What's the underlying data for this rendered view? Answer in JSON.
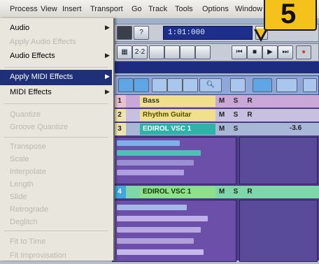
{
  "menubar": {
    "items": [
      "Process",
      "View",
      "Insert",
      "Transport",
      "Go",
      "Track",
      "Tools",
      "Options",
      "Window"
    ]
  },
  "menu": {
    "items": [
      {
        "label": "Audio",
        "submenu": true,
        "enabled": true
      },
      {
        "label": "Apply Audio Effects",
        "submenu": false,
        "enabled": false
      },
      {
        "label": "Audio Effects",
        "submenu": true,
        "enabled": true
      },
      {
        "label": "Apply MIDI Effects",
        "submenu": true,
        "enabled": true,
        "highlighted": true
      },
      {
        "label": "MIDI Effects",
        "submenu": true,
        "enabled": true
      },
      {
        "label": "Quantize",
        "submenu": false,
        "enabled": false
      },
      {
        "label": "Groove Quantize",
        "submenu": false,
        "enabled": false
      },
      {
        "label": "Transpose",
        "submenu": false,
        "enabled": false
      },
      {
        "label": "Scale",
        "submenu": false,
        "enabled": false
      },
      {
        "label": "Interpolate",
        "submenu": false,
        "enabled": false
      },
      {
        "label": "Length",
        "submenu": false,
        "enabled": false
      },
      {
        "label": "Slide",
        "submenu": false,
        "enabled": false
      },
      {
        "label": "Retrograde",
        "submenu": false,
        "enabled": false
      },
      {
        "label": "Deglitch",
        "submenu": false,
        "enabled": false
      },
      {
        "label": "Fit to Time",
        "submenu": false,
        "enabled": false
      },
      {
        "label": "Fit Improvisation",
        "submenu": false,
        "enabled": false
      }
    ]
  },
  "transport": {
    "counter": "1:01:000",
    "help_label": "?"
  },
  "toolbar": {
    "button_2x2": "2·2"
  },
  "tracks": [
    {
      "number": "1",
      "name": "Bass",
      "mute": "M",
      "solo": "S",
      "record": "R",
      "volume": ""
    },
    {
      "number": "2",
      "name": "Rhythm Guitar",
      "mute": "M",
      "solo": "S",
      "record": "R",
      "volume": ""
    },
    {
      "number": "3",
      "name": "EDIROL VSC 1",
      "mute": "M",
      "solo": "S",
      "record": "",
      "volume": "-3.6"
    },
    {
      "number": "4",
      "name": "EDIROL VSC 1",
      "mute": "M",
      "solo": "S",
      "record": "R",
      "volume": ""
    }
  ],
  "callout": {
    "step": "5"
  },
  "colors": {
    "menu_highlight": "#1f2f78",
    "track_name_yellow": "#f0e08a",
    "track_name_cyan": "#2fb3a8",
    "track_name_green": "#8fe08a",
    "callout_yellow": "#f5c21b"
  }
}
